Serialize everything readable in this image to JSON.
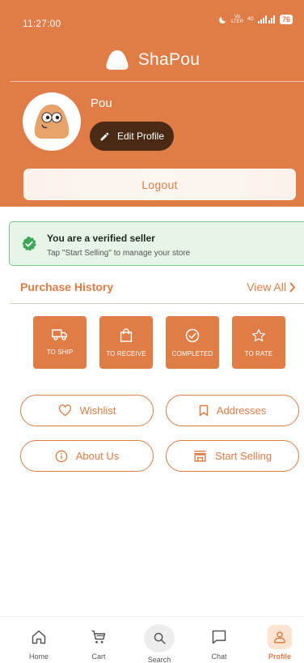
{
  "status": {
    "time": "11:27:00",
    "network_top": "Vo",
    "network_bottom": "LTER",
    "signal": "4G",
    "battery": "76"
  },
  "brand": {
    "name": "ShaPou"
  },
  "profile": {
    "username": "Pou",
    "edit_label": "Edit Profile",
    "logout_label": "Logout"
  },
  "verified": {
    "title": "You are a verified seller",
    "subtitle": "Tap \"Start Selling\" to manage your store"
  },
  "purchase_history": {
    "title": "Purchase History",
    "view_all": "View All",
    "tiles": [
      {
        "label": "TO SHIP",
        "icon": "truck-icon"
      },
      {
        "label": "TO RECEIVE",
        "icon": "shopping-bag-icon"
      },
      {
        "label": "COMPLETED",
        "icon": "check-circle-icon"
      },
      {
        "label": "TO RATE",
        "icon": "star-icon"
      }
    ]
  },
  "actions": {
    "wishlist": "Wishlist",
    "addresses": "Addresses",
    "about": "About Us",
    "start_selling": "Start Selling"
  },
  "nav": {
    "home": "Home",
    "cart": "Cart",
    "search": "Search",
    "chat": "Chat",
    "profile": "Profile"
  },
  "colors": {
    "brand": "#e07c45",
    "dark": "#4a2a14",
    "verified_bg": "#e6f5e8",
    "verified_border": "#7cc58a",
    "verified_check": "#3aa757"
  }
}
